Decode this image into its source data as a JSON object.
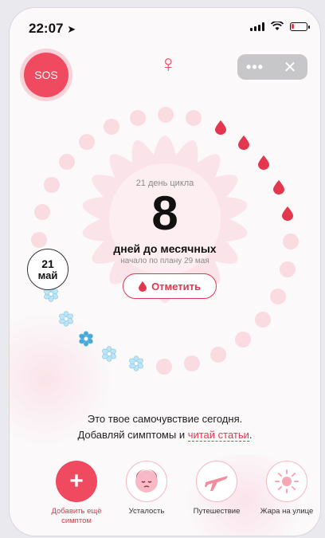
{
  "status": {
    "time": "22:07"
  },
  "header": {
    "sos_label": "SOS",
    "menu_dots": "•••",
    "close_glyph": "✕",
    "venus_glyph": "♀"
  },
  "cycle": {
    "day_text": "21 день цикла",
    "days_left": "8",
    "until_text": "дней до месячных",
    "plan_text": "начало по плану 29 мая",
    "mark_button": "Отметить"
  },
  "date_badge": {
    "day": "21",
    "month": "май"
  },
  "message": {
    "line1": "Это твое самочувствие сегодня.",
    "line2_prefix": "Добавляй симптомы и ",
    "line2_link": "читай статьи",
    "line2_suffix": "."
  },
  "symptoms": [
    {
      "label": "Добавить ещё симптом",
      "icon": "plus-icon"
    },
    {
      "label": "Усталость",
      "icon": "tired-face-icon"
    },
    {
      "label": "Путешествие",
      "icon": "airplane-icon"
    },
    {
      "label": "Жара на улице",
      "icon": "sun-icon"
    }
  ],
  "colors": {
    "accent": "#EF4A5F",
    "period": "#E2374F",
    "fertile": "#7CC7E6",
    "dot": "#F9DBE1"
  }
}
